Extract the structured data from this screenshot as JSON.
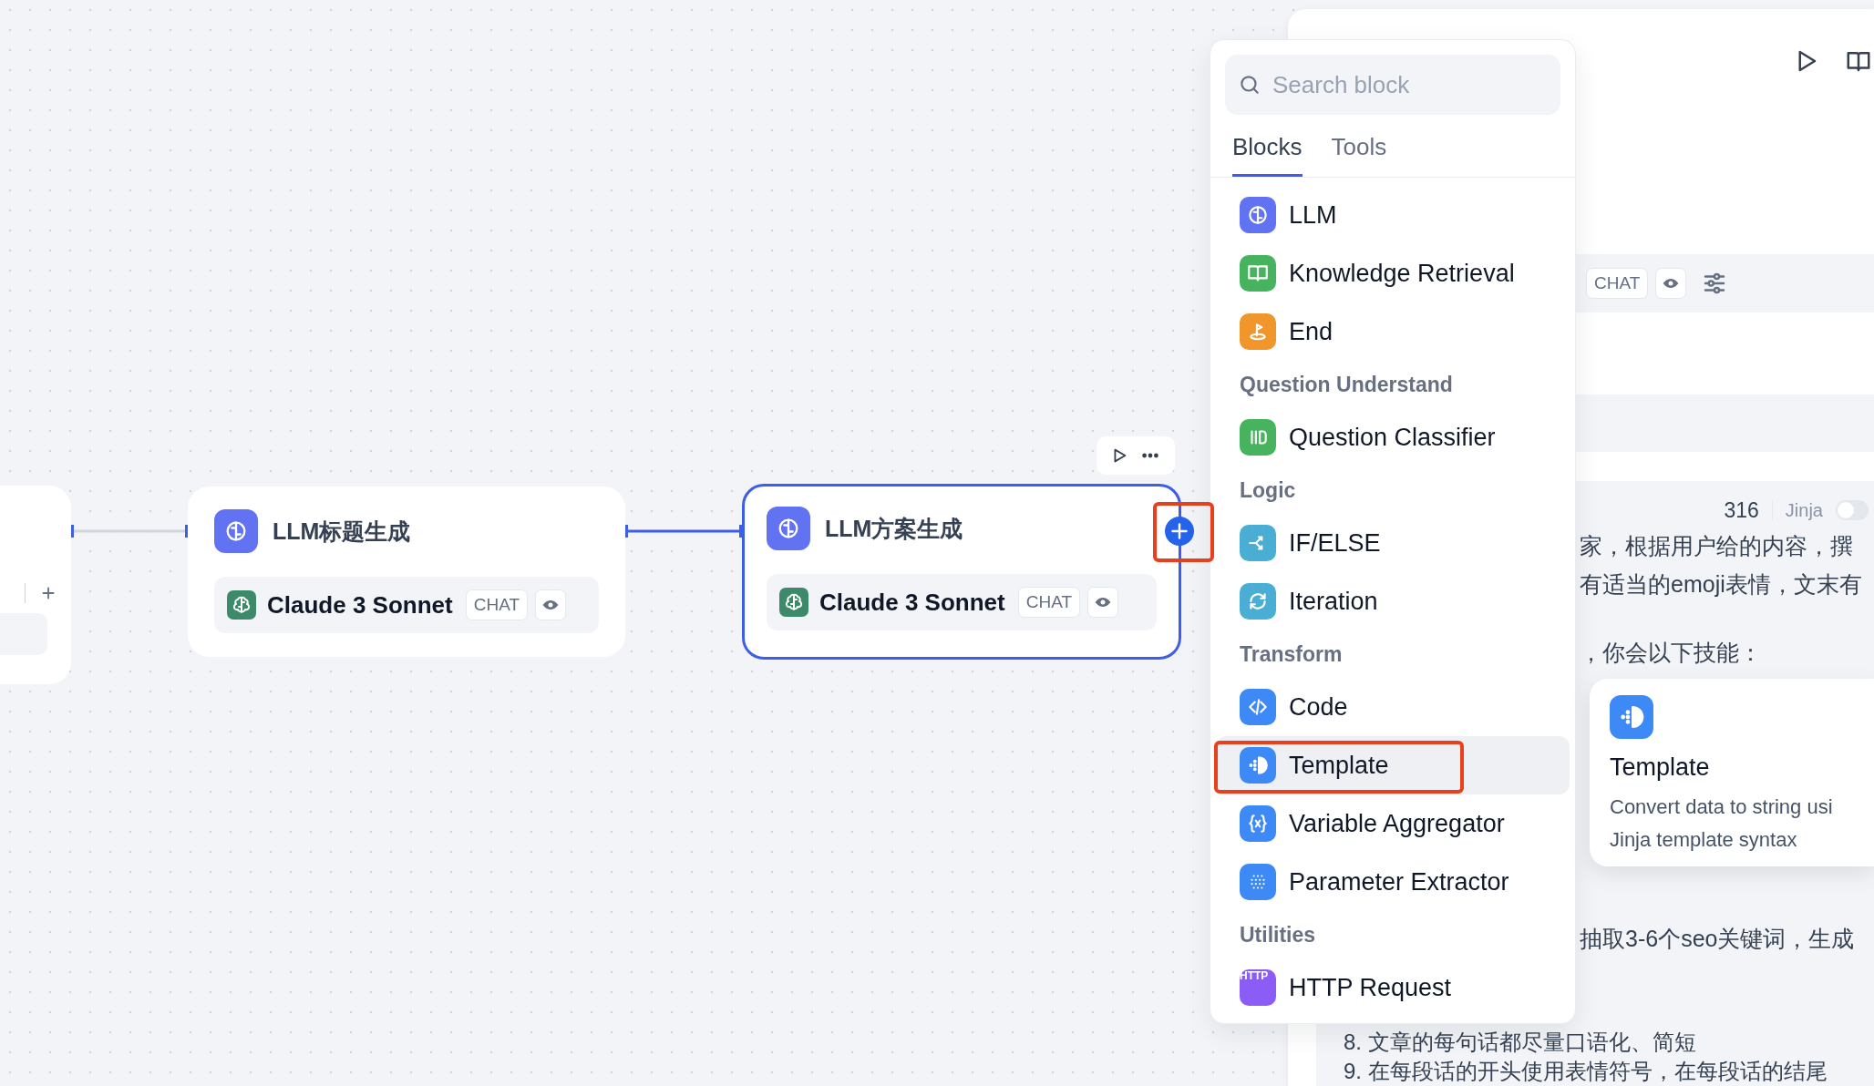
{
  "canvas": {
    "nodes": [
      {
        "title": "LLM标题生成",
        "model": "Claude 3 Sonnet",
        "mode": "CHAT",
        "selected": false
      },
      {
        "title": "LLM方案生成",
        "model": "Claude 3 Sonnet",
        "mode": "CHAT",
        "selected": true,
        "highlighted": true
      }
    ]
  },
  "block_menu": {
    "search": {
      "placeholder": "Search block"
    },
    "tabs": [
      {
        "label": "Blocks",
        "selected": true
      },
      {
        "label": "Tools",
        "selected": false
      }
    ],
    "entries": [
      {
        "kind": "block",
        "label": "LLM",
        "color": "#6172f3",
        "selected": false
      },
      {
        "kind": "block",
        "label": "Knowledge Retrieval",
        "color": "#47b35f",
        "selected": false
      },
      {
        "kind": "block",
        "label": "End",
        "color": "#f0962a",
        "selected": false
      },
      {
        "kind": "group",
        "label": "Question Understand"
      },
      {
        "kind": "block",
        "label": "Question Classifier",
        "color": "#47b35f",
        "selected": false
      },
      {
        "kind": "group",
        "label": "Logic"
      },
      {
        "kind": "block",
        "label": "IF/ELSE",
        "color": "#4aaed4",
        "selected": false
      },
      {
        "kind": "block",
        "label": "Iteration",
        "color": "#4aaed4",
        "selected": false
      },
      {
        "kind": "group",
        "label": "Transform"
      },
      {
        "kind": "block",
        "label": "Code",
        "color": "#3d8af7",
        "selected": false
      },
      {
        "kind": "block",
        "label": "Template",
        "color": "#3d8af7",
        "selected": true,
        "highlighted": true
      },
      {
        "kind": "block",
        "label": "Variable Aggregator",
        "color": "#3d8af7",
        "selected": false
      },
      {
        "kind": "block",
        "label": "Parameter Extractor",
        "color": "#3d8af7",
        "selected": false
      },
      {
        "kind": "group",
        "label": "Utilities"
      },
      {
        "kind": "block",
        "label": "HTTP Request",
        "color": "#8b5cf6",
        "badge": "HTTP",
        "selected": false
      }
    ]
  },
  "tooltip": {
    "title": "Template",
    "description": [
      "Convert data to string usi",
      "Jinja template syntax"
    ]
  },
  "panel": {
    "model_mode": "CHAT",
    "prompt": {
      "char_count": "316",
      "jinja": {
        "label": "Jinja",
        "on": false
      },
      "fragments": [
        "家，根据用户给的内容，撰",
        "有适当的emoji表情，文末有",
        "，你会以下技能：",
        "抽取3-6个seo关键词，生成"
      ],
      "lines": [
        "8. 文章的每句话都尽量口语化、简短",
        "9. 在每段话的开头使用表情符号，在每段话的结尾"
      ]
    }
  }
}
